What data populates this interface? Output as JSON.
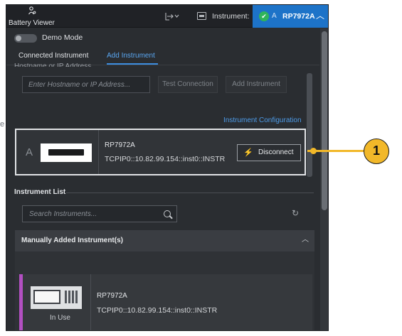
{
  "app": {
    "title": "Battery Viewer",
    "logo_icon": "person-settings-icon"
  },
  "header": {
    "export_icon": "export-icon",
    "instrument_icon": "instrument-icon",
    "instrument_label": "Instrument:",
    "status_check": "✔",
    "status_letter": "A",
    "selected_instrument": "RP7972A",
    "chevron": "︿"
  },
  "demo_mode": {
    "label": "Demo Mode",
    "enabled": false
  },
  "tabs": [
    {
      "label": "Connected Instrument",
      "active": false
    },
    {
      "label": "Add Instrument",
      "active": true
    }
  ],
  "add_instrument": {
    "section_heading": "Hostname or IP Address",
    "hostname_placeholder": "Enter Hostname or IP Address...",
    "test_connection_label": "Test Connection",
    "add_instrument_label": "Add Instrument",
    "config_link": "Instrument Configuration"
  },
  "connected_instrument": {
    "letter": "A",
    "name": "RP7972A",
    "address": "TCPIP0::10.82.99.154::inst0::INSTR",
    "disconnect_label": "Disconnect",
    "disconnect_icon": "⚡"
  },
  "instrument_list": {
    "heading": "Instrument List",
    "search_placeholder": "Search Instruments...",
    "refresh_icon": "↻",
    "group_label": "Manually Added Instrument(s)",
    "group_chevron": "︿",
    "items": [
      {
        "name": "RP7972A",
        "address": "TCPIP0::10.82.99.154::inst0::INSTR",
        "status": "In Use"
      }
    ]
  },
  "left_fragment": "e",
  "callout": {
    "number": "1"
  },
  "colors": {
    "accent": "#1d73c8",
    "link": "#4d9be8",
    "callout": "#f2b829",
    "item_accent": "#b24fc1",
    "ok": "#2fb45a"
  }
}
